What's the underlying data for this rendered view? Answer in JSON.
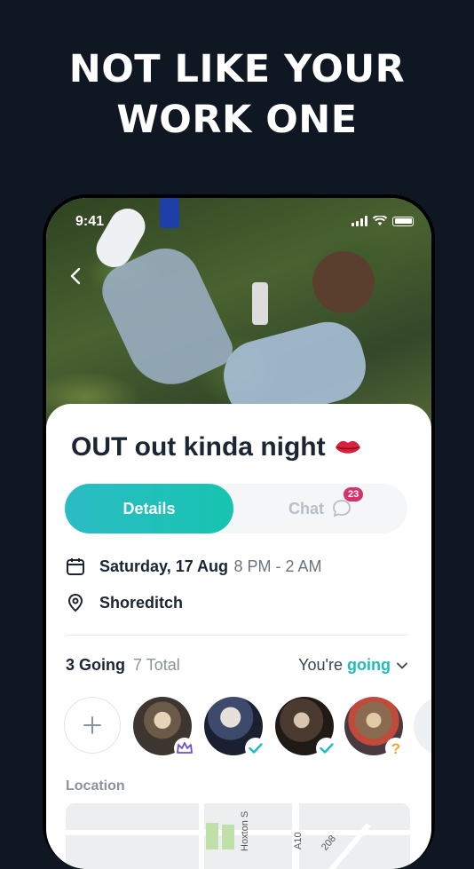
{
  "headline": {
    "line1": "NOT LIKE YOUR",
    "line2": "WORK ONE"
  },
  "status_bar": {
    "time": "9:41"
  },
  "event": {
    "title": "OUT out kinda night",
    "title_emoji": "lips-icon",
    "tabs": {
      "details": "Details",
      "chat": "Chat",
      "chat_badge": "23"
    },
    "date": "Saturday, 17 Aug",
    "time_range": "8 PM - 2 AM",
    "location_name": "Shoreditch",
    "going_count": "3 Going",
    "total_count": "7 Total",
    "rsvp_prefix": "You're",
    "rsvp_status": "going",
    "location_label": "Location",
    "map_labels": {
      "street1": "Hoxton S",
      "street2": "A10",
      "street3": "208"
    }
  },
  "attendees": [
    {
      "name": "avatar-1",
      "badge": "crown-icon"
    },
    {
      "name": "avatar-2",
      "badge": "check-icon"
    },
    {
      "name": "avatar-3",
      "badge": "check-icon"
    },
    {
      "name": "avatar-4",
      "badge": "question-icon"
    }
  ],
  "colors": {
    "background": "#0f1722",
    "accent_teal": "#1fbcbc",
    "badge_pink": "#d6336c",
    "crown_purple": "#6a4fd6",
    "question_orange": "#f2a33a"
  }
}
